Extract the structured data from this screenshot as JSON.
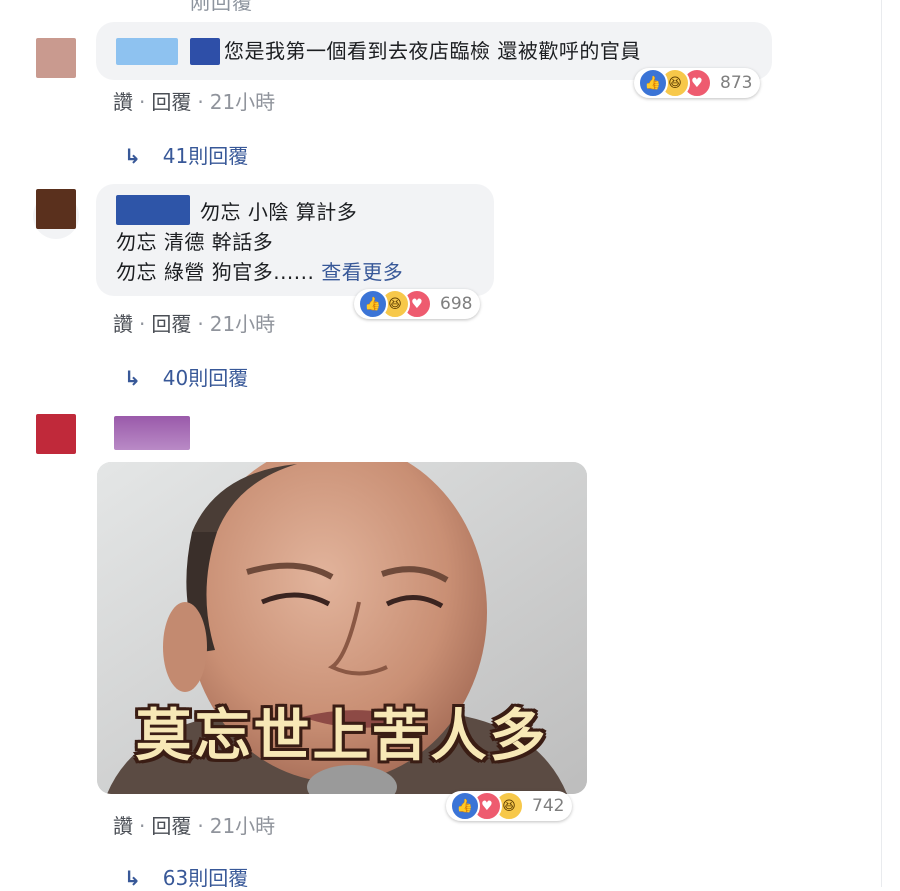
{
  "top_fragment": "刚回覆",
  "comments": [
    {
      "text_lines": [
        "您是我第一個看到去夜店臨檢 還被歡呼的官員"
      ],
      "reaction_count": "873",
      "actions": {
        "like": "讚",
        "reply": "回覆",
        "time": "21小時"
      },
      "replies_label": "41則回覆",
      "avatar_color": "#c99a8f",
      "name_colors": [
        "#8ec2f0",
        "#2e4fa8"
      ]
    },
    {
      "text_lines": [
        "勿忘 小陰 算計多",
        "勿忘 清德 幹話多",
        "勿忘 綠營 狗官多......"
      ],
      "see_more": "查看更多",
      "reaction_count": "698",
      "actions": {
        "like": "讚",
        "reply": "回覆",
        "time": "21小時"
      },
      "replies_label": "40則回覆",
      "avatar_color": "#5a301d",
      "name_colors": [
        "#2e55a8"
      ]
    },
    {
      "photo_caption": "莫忘世上苦人多",
      "reaction_count": "742",
      "actions": {
        "like": "讚",
        "reply": "回覆",
        "time": "21小時"
      },
      "replies_label": "63則回覆",
      "avatar_color": "#c0293a",
      "name_colors": [
        "#9a5aaa"
      ]
    }
  ],
  "icons": {
    "like": "thumbs-up-icon",
    "haha": "laughing-face-icon",
    "love": "heart-icon",
    "reply_arrow": "reply-arrow-icon"
  },
  "colors": {
    "link": "#385898",
    "bubble": "#f2f3f5",
    "like": "#3b74d6",
    "haha": "#f7c84a",
    "love": "#ee5b6f"
  }
}
